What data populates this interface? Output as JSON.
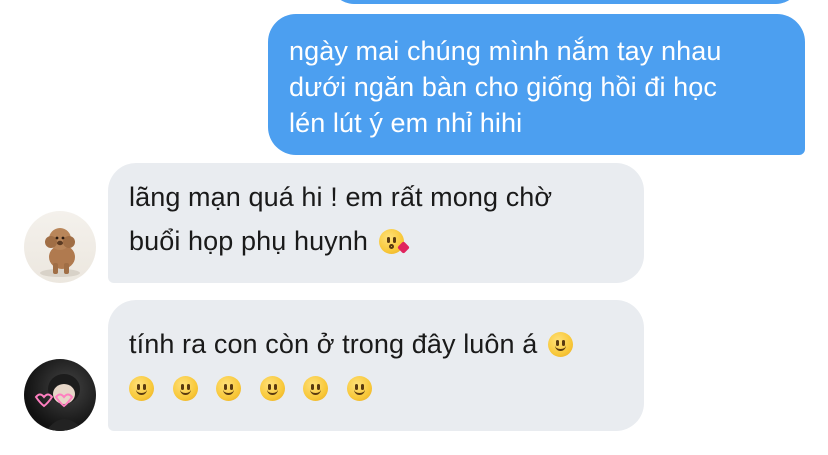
{
  "conversation": {
    "messages": [
      {
        "direction": "sent",
        "lines": [
          "ngày mai chúng mình nắm tay nhau",
          "dưới ngăn bàn cho giống hồi đi học",
          "lén lút ý em nhỉ hihi"
        ]
      },
      {
        "direction": "received",
        "avatar": "dog-avatar",
        "lines": [
          "lãng mạn quá hi ! em rất mong chờ",
          "buổi họp phụ huynh"
        ],
        "emoji": [
          "kissing-face-with-heart-emoji"
        ]
      },
      {
        "direction": "received",
        "avatar": "person-avatar",
        "lines": [
          "tính ra con còn ở trong đây luôn á"
        ],
        "emoji": [
          "smiling-face-emoji",
          "smiling-face-emoji",
          "smiling-face-emoji",
          "smiling-face-emoji",
          "smiling-face-emoji",
          "smiling-face-emoji",
          "smiling-face-emoji"
        ]
      }
    ]
  },
  "colors": {
    "sent_bubble": "#4c9ff0",
    "received_bubble": "#e9ecf0",
    "sent_text": "#ffffff",
    "received_text": "#1a1a1a"
  }
}
